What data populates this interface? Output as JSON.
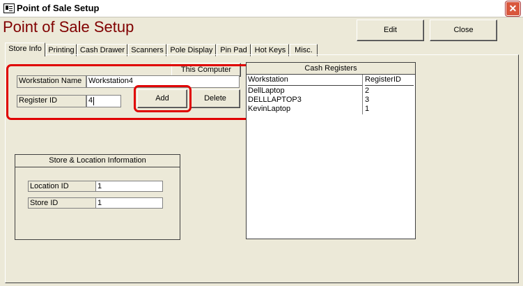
{
  "window": {
    "title": "Point of Sale Setup",
    "close_glyph": "✕"
  },
  "form": {
    "title": "Point of Sale Setup"
  },
  "toolbar": {
    "edit_label": "Edit",
    "close_label": "Close"
  },
  "tabs": [
    {
      "label": "Store Info"
    },
    {
      "label": "Printing"
    },
    {
      "label": "Cash Drawer"
    },
    {
      "label": "Scanners"
    },
    {
      "label": "Pole Display"
    },
    {
      "label": "Pin Pad"
    },
    {
      "label": "Hot Keys"
    },
    {
      "label": "Misc."
    }
  ],
  "register": {
    "this_computer_label": "This Computer",
    "workstation_name_label": "Workstation Name",
    "workstation_name_value": "Workstation4",
    "register_id_label": "Register ID",
    "register_id_value": "4",
    "add_label": "Add",
    "delete_label": "Delete"
  },
  "store_location": {
    "title": "Store & Location Information",
    "location_id_label": "Location ID",
    "location_id_value": "1",
    "store_id_label": "Store ID",
    "store_id_value": "1"
  },
  "cash_registers": {
    "title": "Cash Registers",
    "columns": [
      "Workstation",
      "RegisterID"
    ],
    "rows": [
      {
        "workstation": "DellLaptop",
        "register_id": "2"
      },
      {
        "workstation": "DELLLAPTOP3",
        "register_id": "3"
      },
      {
        "workstation": "KevinLaptop",
        "register_id": "1"
      }
    ]
  },
  "colors": {
    "title_text": "#800000",
    "highlight": "#e00000",
    "face": "#ECE9D8"
  }
}
